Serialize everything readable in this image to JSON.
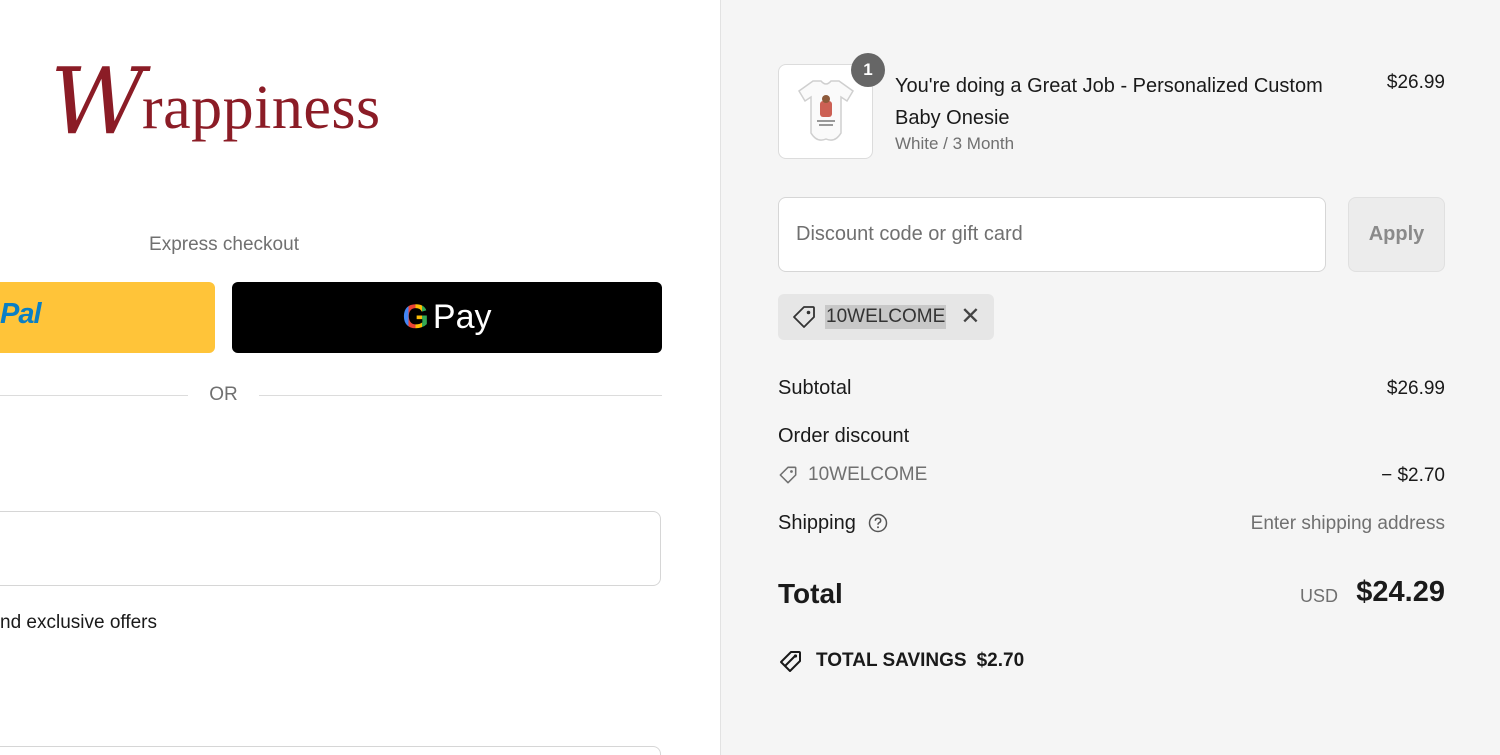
{
  "brand": {
    "logo_initial": "W",
    "logo_rest": "rappiness",
    "color": "#8b1c26"
  },
  "express": {
    "label": "Express checkout",
    "paypal_label": "Pal",
    "gpay_label": "Pay",
    "gpay_g": "G",
    "or_label": "OR"
  },
  "contact": {
    "email_placeholder": "",
    "offers_text": "nd exclusive offers"
  },
  "order": {
    "item": {
      "title": "You're doing a Great Job - Personalized Custom Baby Onesie",
      "variant": "White / 3 Month",
      "price": "$26.99",
      "quantity": "1"
    },
    "discount": {
      "placeholder": "Discount code or gift card",
      "apply_label": "Apply",
      "applied_code": "10WELCOME",
      "remove_symbol": "✕"
    },
    "summary": {
      "subtotal_label": "Subtotal",
      "subtotal_value": "$26.99",
      "order_discount_label": "Order discount",
      "discount_code": "10WELCOME",
      "discount_value": "− $2.70",
      "shipping_label": "Shipping",
      "shipping_value": "Enter shipping address",
      "total_label": "Total",
      "total_currency": "USD",
      "total_value": "$24.29",
      "savings_label": "TOTAL SAVINGS",
      "savings_value": "$2.70"
    }
  },
  "colors": {
    "paypal_yellow": "#ffc439",
    "gpay_black": "#000000",
    "panel_bg": "#f5f5f5"
  }
}
